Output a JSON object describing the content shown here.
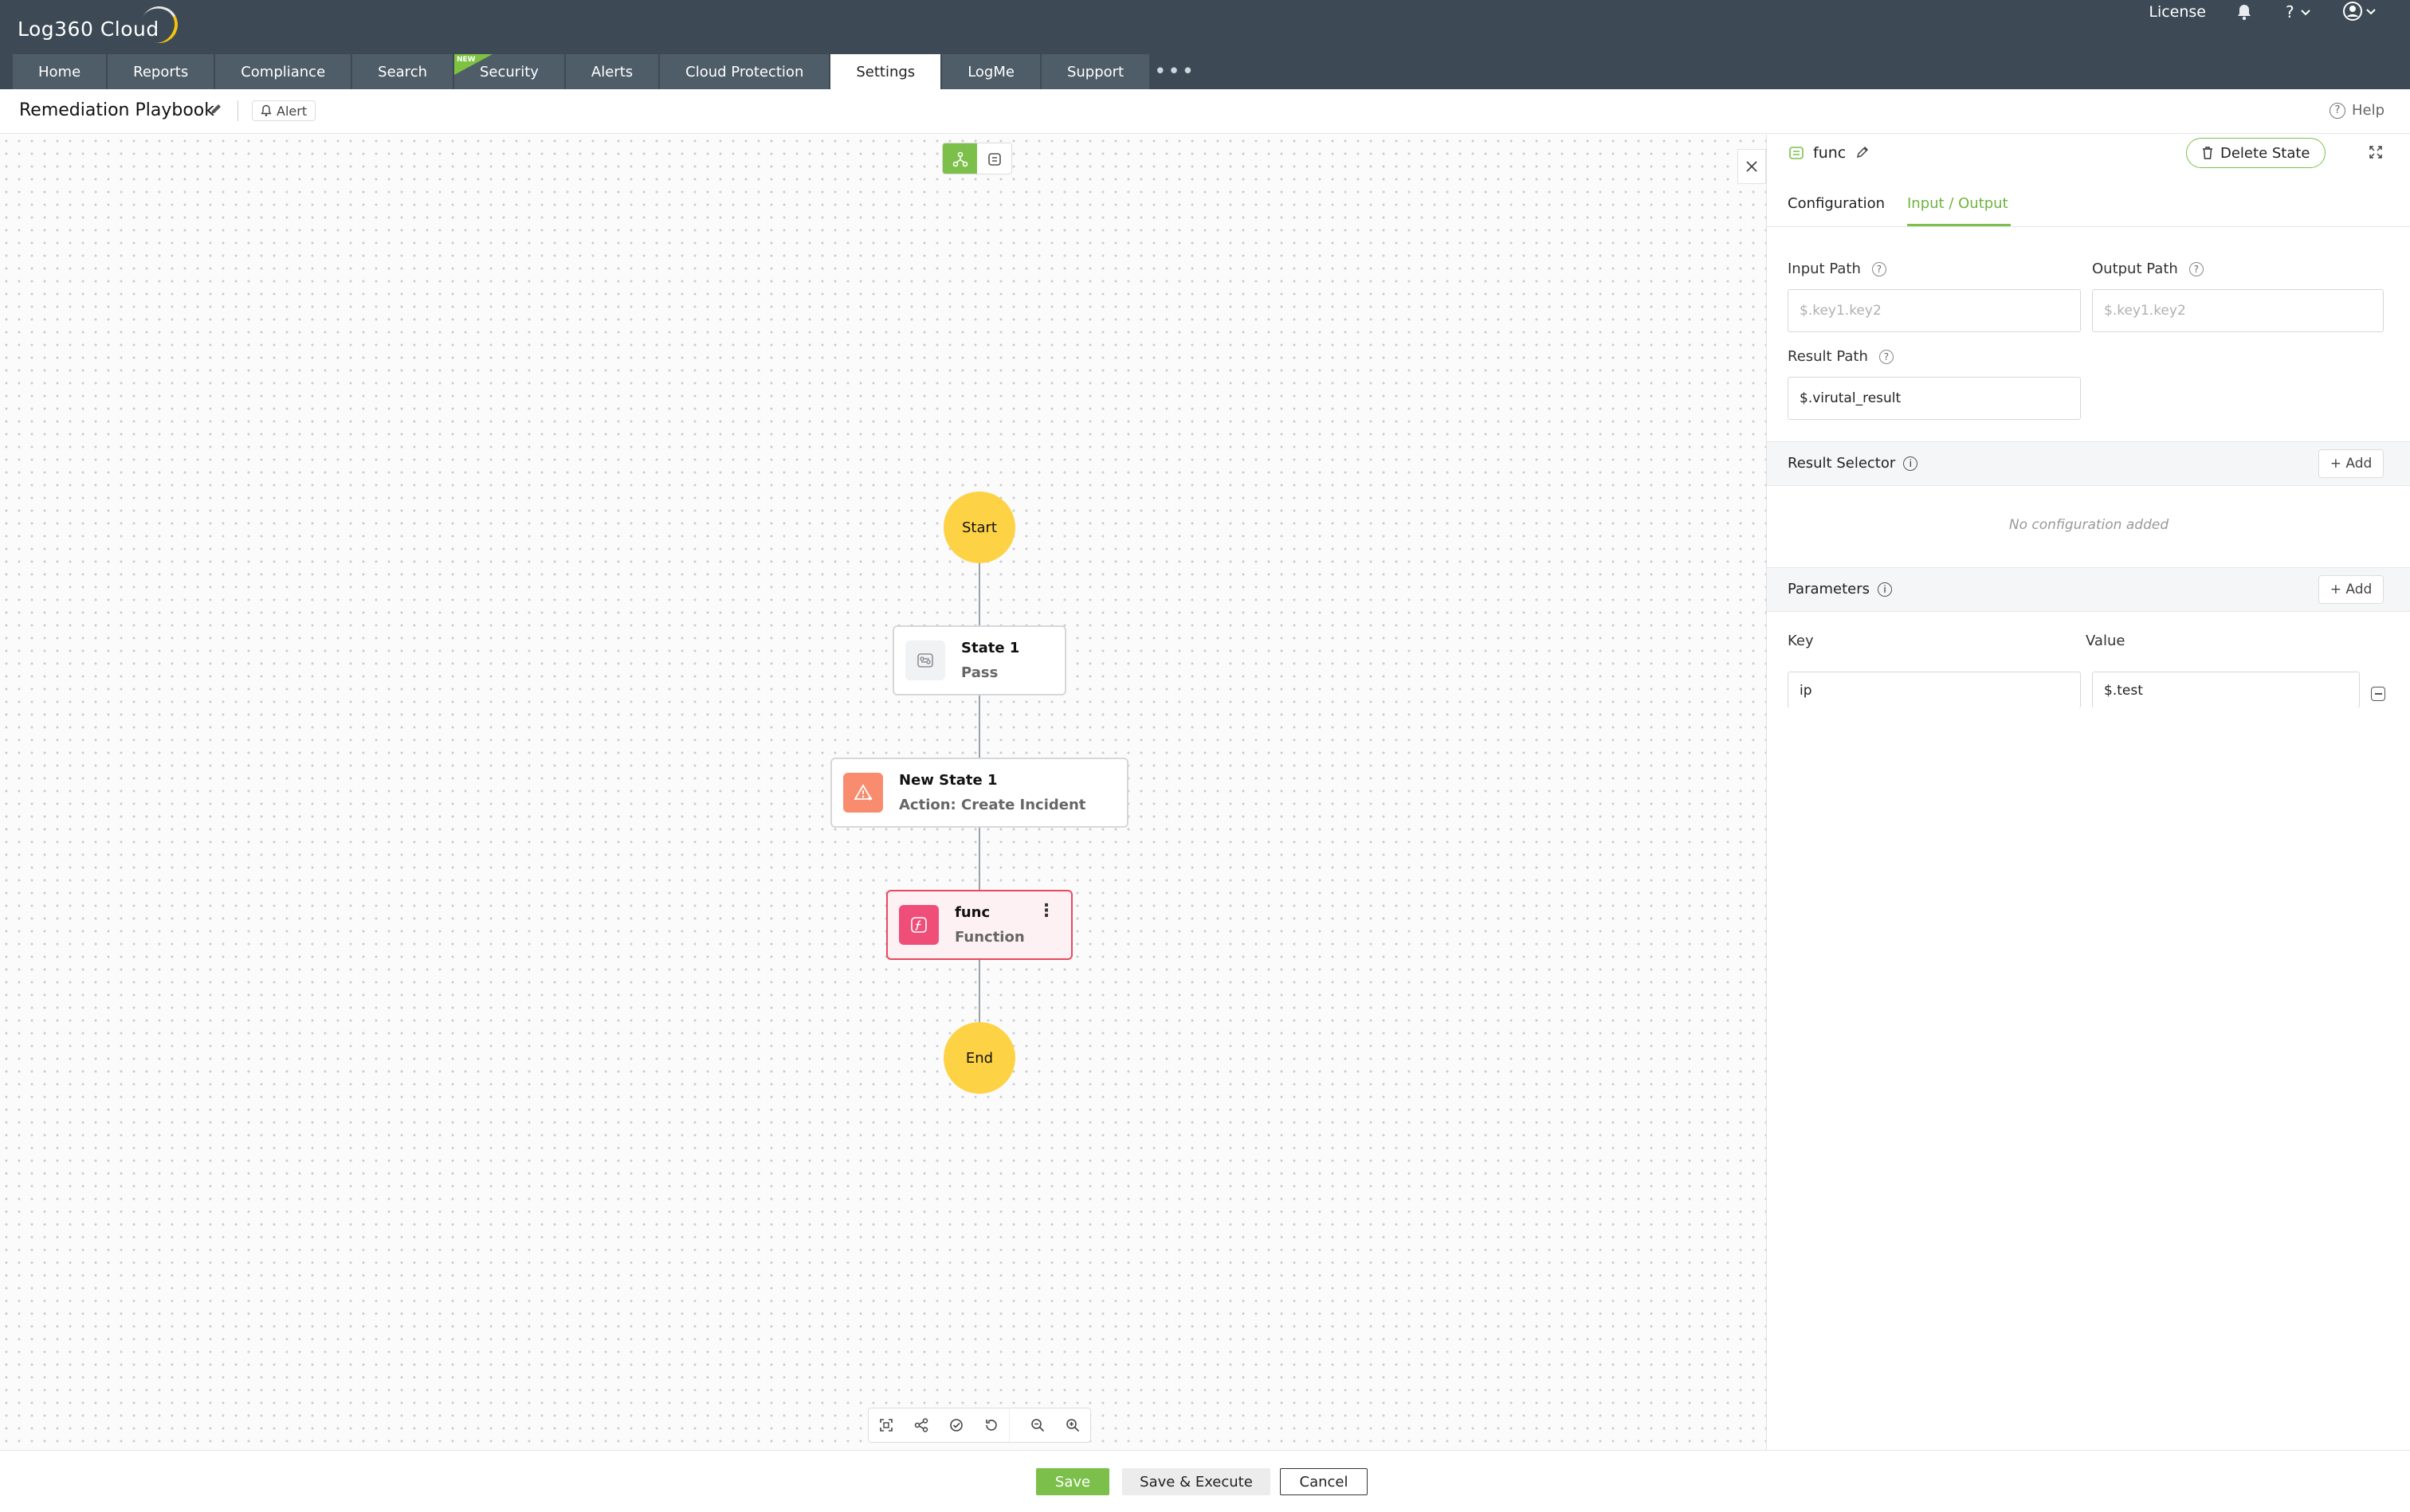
{
  "app": {
    "logo": "Log360 Cloud"
  },
  "top_right": {
    "license": "License"
  },
  "nav": {
    "tabs": [
      "Home",
      "Reports",
      "Compliance",
      "Search",
      "Security",
      "Alerts",
      "Cloud Protection",
      "Settings",
      "LogMe",
      "Support"
    ],
    "active": "Settings",
    "new_badge": "NEW"
  },
  "titlebar": {
    "title": "Remediation Playbook",
    "alert_chip": "Alert",
    "help": "Help"
  },
  "flow": {
    "start": "Start",
    "end": "End",
    "states": [
      {
        "title": "State 1",
        "subtitle": "Pass"
      },
      {
        "title": "New State 1",
        "subtitle": "Action: Create Incident"
      },
      {
        "title": "func",
        "subtitle": "Function"
      }
    ]
  },
  "panel": {
    "state_name": "func",
    "delete_label": "Delete State",
    "tabs": [
      "Configuration",
      "Input / Output"
    ],
    "active_tab": "Input / Output",
    "input_path": {
      "label": "Input Path",
      "value": "",
      "placeholder": "$.key1.key2"
    },
    "output_path": {
      "label": "Output Path",
      "value": "",
      "placeholder": "$.key1.key2"
    },
    "result_path": {
      "label": "Result Path",
      "value": "$.virutal_result"
    },
    "result_selector": {
      "title": "Result Selector",
      "add_label": "+ Add",
      "empty": "No configuration added"
    },
    "parameters": {
      "title": "Parameters",
      "add_label": "+ Add",
      "key_header": "Key",
      "value_header": "Value",
      "rows": [
        {
          "key": "ip",
          "value": "$.test"
        }
      ]
    }
  },
  "footer": {
    "save": "Save",
    "save_execute": "Save & Execute",
    "cancel": "Cancel"
  },
  "colors": {
    "accent": "#7cc04b",
    "node_yellow": "#fed245",
    "func_pink": "#e8495f",
    "topbar": "#3d4a55"
  }
}
